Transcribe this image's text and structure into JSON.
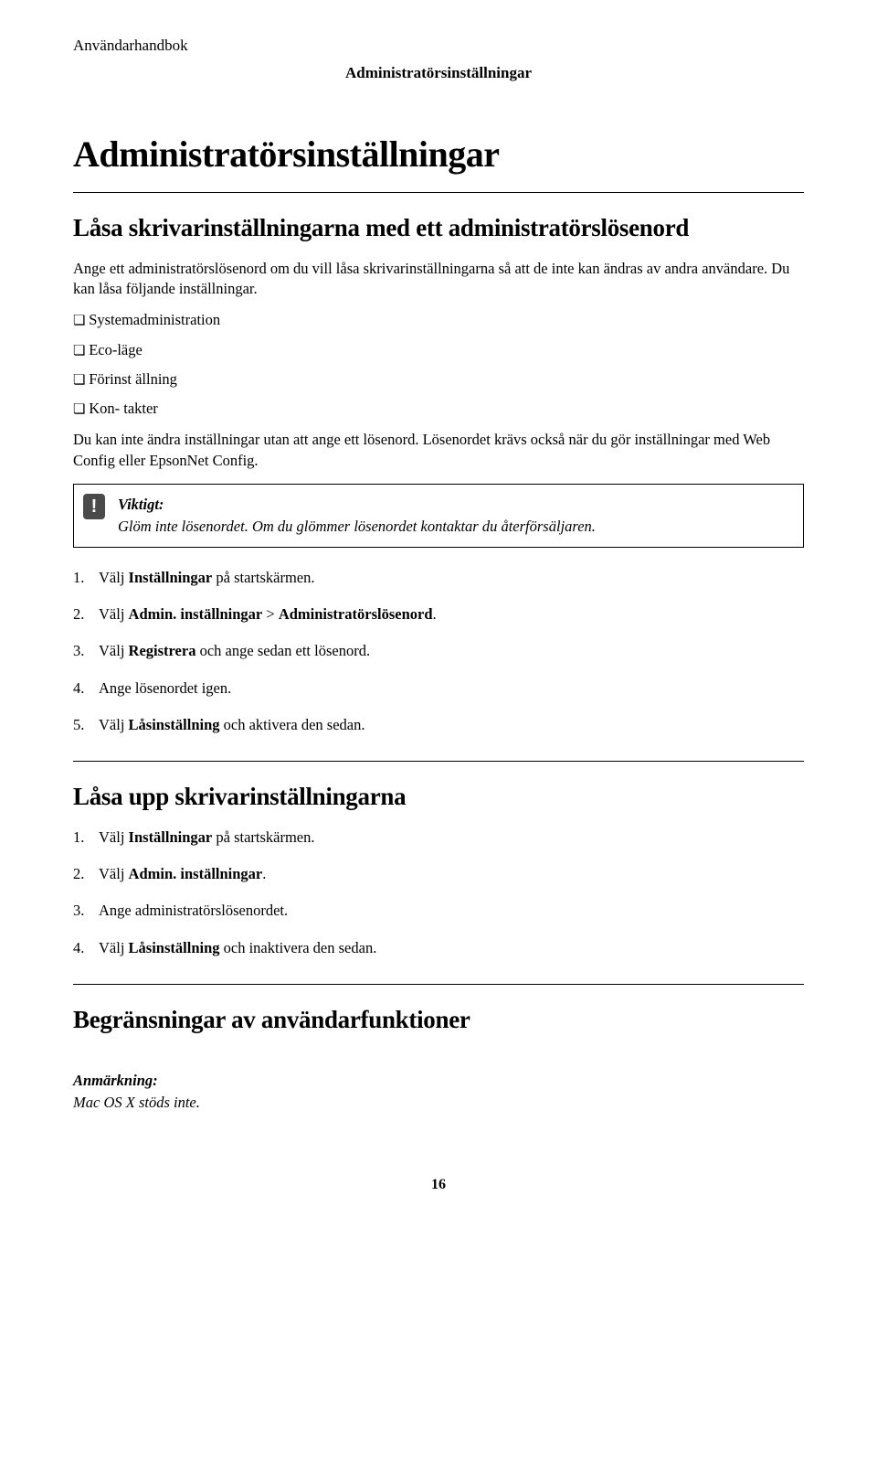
{
  "header": {
    "left": "Användarhandbok",
    "center": "Administratörsinställningar"
  },
  "title": "Administratörsinställningar",
  "section1": {
    "heading": "Låsa skrivarinställningarna med ett administratörslösenord",
    "intro": "Ange ett administratörslösenord om du vill låsa skrivarinställningarna så att de inte kan ändras av andra användare. Du kan låsa följande inställningar.",
    "items": [
      "Systemadministration",
      "Eco-läge",
      "Förinst ällning",
      "Kon- takter"
    ],
    "after_list": "Du kan inte ändra inställningar utan att ange ett lösenord. Lösenordet krävs också när du gör inställningar med Web Config eller EpsonNet Config.",
    "important_label": "Viktigt:",
    "important_text": "Glöm inte lösenordet. Om du glömmer lösenordet kontaktar du återförsäljaren.",
    "steps": [
      {
        "prefix": "Välj ",
        "bold": "Inställningar",
        "suffix": " på startskärmen."
      },
      {
        "prefix": "Välj ",
        "bold": "Admin. inställningar",
        "mid": " > ",
        "bold2": "Administratörslösenord",
        "suffix": "."
      },
      {
        "prefix": "Välj ",
        "bold": "Registrera",
        "suffix": " och ange sedan ett lösenord."
      },
      {
        "prefix": "Ange lösenordet igen.",
        "bold": "",
        "suffix": ""
      },
      {
        "prefix": "Välj ",
        "bold": "Låsinställning",
        "suffix": " och aktivera den sedan."
      }
    ]
  },
  "section2": {
    "heading": "Låsa upp skrivarinställningarna",
    "steps": [
      {
        "prefix": "Välj ",
        "bold": "Inställningar",
        "suffix": " på startskärmen."
      },
      {
        "prefix": "Välj ",
        "bold": "Admin. inställningar",
        "suffix": "."
      },
      {
        "prefix": "Ange administratörslösenordet.",
        "bold": "",
        "suffix": ""
      },
      {
        "prefix": "Välj ",
        "bold": "Låsinställning",
        "suffix": " och inaktivera den sedan."
      }
    ]
  },
  "section3": {
    "heading": "Begränsningar av användarfunktioner",
    "note_label": "Anmärkning:",
    "note_body": "Mac OS X stöds inte."
  },
  "page_number": "16"
}
